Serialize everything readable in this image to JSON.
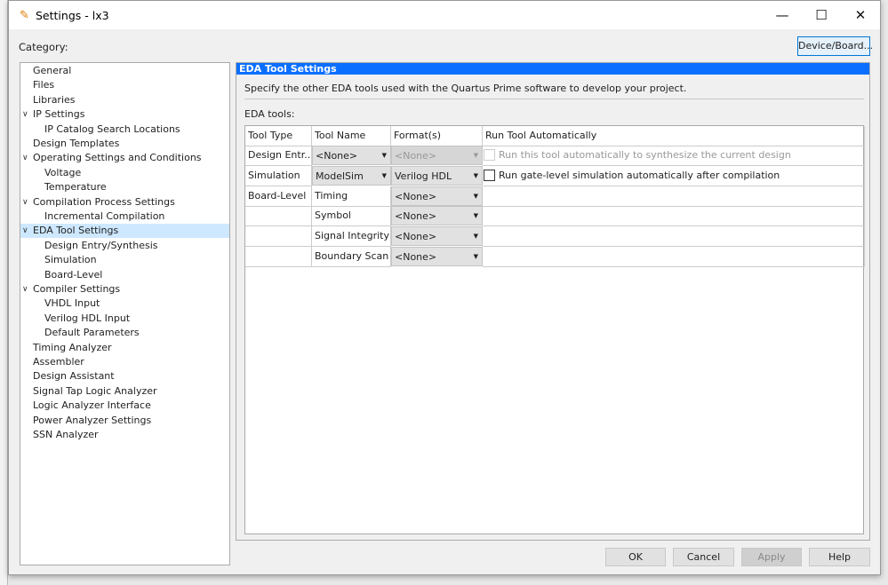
{
  "window": {
    "title": "Settings - lx3",
    "minimize": "—",
    "maximize": "☐",
    "close": "✕"
  },
  "category_label": "Category:",
  "device_button": "Device/Board...",
  "tree": [
    {
      "label": "General",
      "level": 0
    },
    {
      "label": "Files",
      "level": 0
    },
    {
      "label": "Libraries",
      "level": 0
    },
    {
      "label": "IP Settings",
      "level": 0,
      "expanded": true
    },
    {
      "label": "IP Catalog Search Locations",
      "level": 1
    },
    {
      "label": "Design Templates",
      "level": 0
    },
    {
      "label": "Operating Settings and Conditions",
      "level": 0,
      "expanded": true
    },
    {
      "label": "Voltage",
      "level": 1
    },
    {
      "label": "Temperature",
      "level": 1
    },
    {
      "label": "Compilation Process Settings",
      "level": 0,
      "expanded": true
    },
    {
      "label": "Incremental Compilation",
      "level": 1
    },
    {
      "label": "EDA Tool Settings",
      "level": 0,
      "expanded": true,
      "selected": true
    },
    {
      "label": "Design Entry/Synthesis",
      "level": 1
    },
    {
      "label": "Simulation",
      "level": 1
    },
    {
      "label": "Board-Level",
      "level": 1
    },
    {
      "label": "Compiler Settings",
      "level": 0,
      "expanded": true
    },
    {
      "label": "VHDL Input",
      "level": 1
    },
    {
      "label": "Verilog HDL Input",
      "level": 1
    },
    {
      "label": "Default Parameters",
      "level": 1
    },
    {
      "label": "Timing Analyzer",
      "level": 0
    },
    {
      "label": "Assembler",
      "level": 0
    },
    {
      "label": "Design Assistant",
      "level": 0
    },
    {
      "label": "Signal Tap Logic Analyzer",
      "level": 0
    },
    {
      "label": "Logic Analyzer Interface",
      "level": 0
    },
    {
      "label": "Power Analyzer Settings",
      "level": 0
    },
    {
      "label": "SSN Analyzer",
      "level": 0
    }
  ],
  "panel": {
    "title": "EDA Tool Settings",
    "description": "Specify the other EDA tools used with the Quartus Prime software to develop your project.",
    "eda_label": "EDA tools:",
    "headers": [
      "Tool Type",
      "Tool Name",
      "Format(s)",
      "Run Tool Automatically"
    ],
    "rows": [
      {
        "type": "Design Entr...",
        "tool": "<None>",
        "tool_combo": true,
        "format": "<None>",
        "format_disabled": true,
        "run": "Run this tool automatically to synthesize the current design",
        "run_disabled": true
      },
      {
        "type": "Simulation",
        "tool": "ModelSim",
        "tool_combo": true,
        "format": "Verilog HDL",
        "run": "Run gate-level simulation automatically after compilation"
      },
      {
        "type": "Board-Level",
        "tool": "Timing",
        "format": "<None>"
      },
      {
        "type": "",
        "tool": "Symbol",
        "format": "<None>"
      },
      {
        "type": "",
        "tool": "Signal Integrity",
        "format": "<None>"
      },
      {
        "type": "",
        "tool": "Boundary Scan",
        "format": "<None>"
      }
    ]
  },
  "buttons": {
    "ok": "OK",
    "cancel": "Cancel",
    "apply": "Apply",
    "help": "Help"
  },
  "colors": {
    "accent": "#0a6fff",
    "selection": "#cde8ff"
  }
}
